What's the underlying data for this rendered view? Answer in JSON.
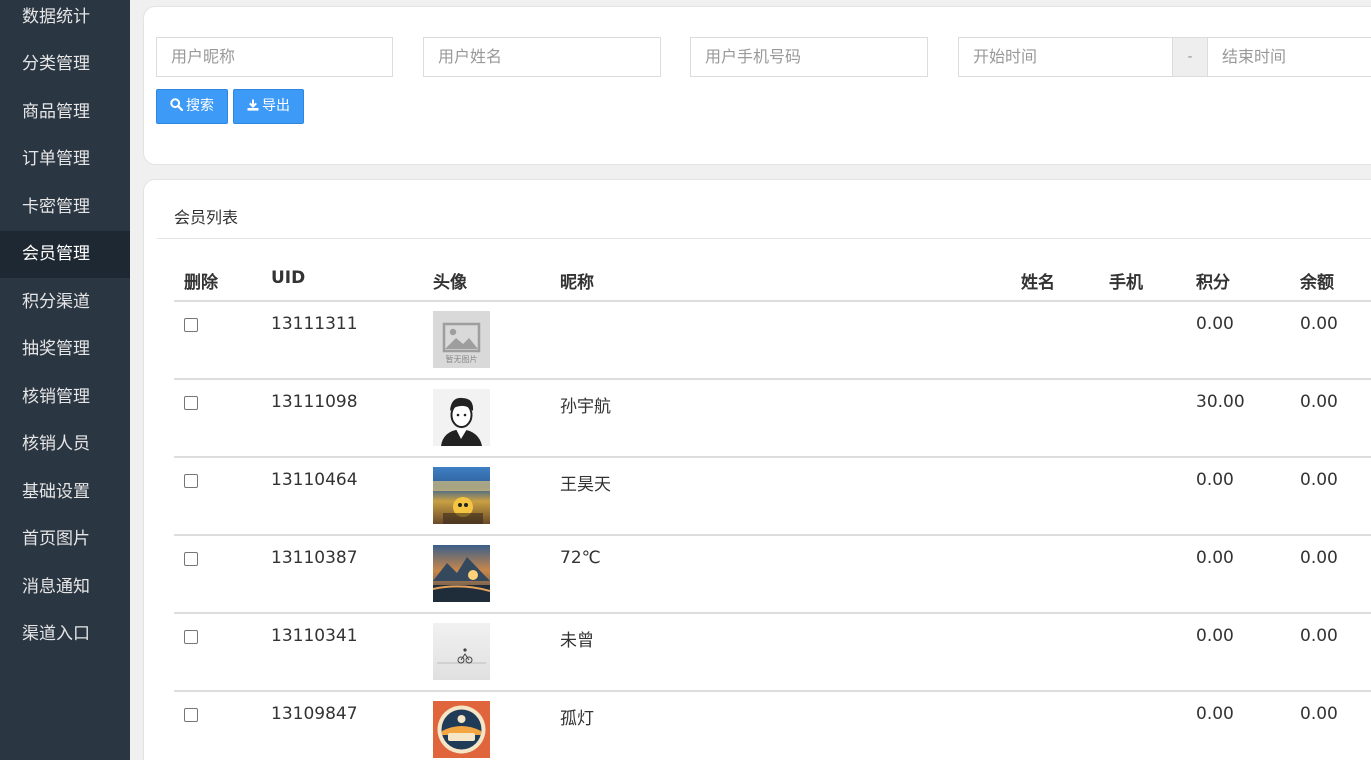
{
  "sidebar": {
    "items": [
      {
        "label": "数据统计"
      },
      {
        "label": "分类管理"
      },
      {
        "label": "商品管理"
      },
      {
        "label": "订单管理"
      },
      {
        "label": "卡密管理"
      },
      {
        "label": "会员管理",
        "active": true
      },
      {
        "label": "积分渠道"
      },
      {
        "label": "抽奖管理"
      },
      {
        "label": "核销管理"
      },
      {
        "label": "核销人员"
      },
      {
        "label": "基础设置"
      },
      {
        "label": "首页图片"
      },
      {
        "label": "消息通知"
      },
      {
        "label": "渠道入口"
      }
    ]
  },
  "search": {
    "nickname_placeholder": "用户昵称",
    "name_placeholder": "用户姓名",
    "phone_placeholder": "用户手机号码",
    "start_placeholder": "开始时间",
    "range_separator": "-",
    "end_placeholder": "结束时间",
    "search_label": "搜索",
    "export_label": "导出"
  },
  "list": {
    "title": "会员列表",
    "columns": {
      "delete": "删除",
      "uid": "UID",
      "avatar": "头像",
      "nickname": "昵称",
      "name": "姓名",
      "phone": "手机",
      "points": "积分",
      "balance": "余额"
    },
    "rows": [
      {
        "uid": "13111311",
        "avatar": "no-image-placeholder",
        "avatar_caption": "暂无图片",
        "nickname": "",
        "name": "",
        "phone": "",
        "points": "0.00",
        "balance": "0.00"
      },
      {
        "uid": "13111098",
        "avatar": "boy-illustration",
        "nickname": "孙宇航",
        "name": "",
        "phone": "",
        "points": "30.00",
        "balance": "0.00"
      },
      {
        "uid": "13110464",
        "avatar": "cartoon-stadium",
        "nickname": "王昊天",
        "name": "",
        "phone": "",
        "points": "0.00",
        "balance": "0.00"
      },
      {
        "uid": "13110387",
        "avatar": "mountain-sunset",
        "nickname": "72℃",
        "name": "",
        "phone": "",
        "points": "0.00",
        "balance": "0.00"
      },
      {
        "uid": "13110341",
        "avatar": "cyclist-foggy",
        "nickname": "未曾",
        "name": "",
        "phone": "",
        "points": "0.00",
        "balance": "0.00"
      },
      {
        "uid": "13109847",
        "avatar": "badge-orange",
        "nickname": "孤灯",
        "name": "",
        "phone": "",
        "points": "0.00",
        "balance": "0.00"
      }
    ]
  },
  "colors": {
    "sidebar_bg": "#2b3643",
    "sidebar_active": "#1e2833",
    "button_primary": "#3d9af6"
  }
}
